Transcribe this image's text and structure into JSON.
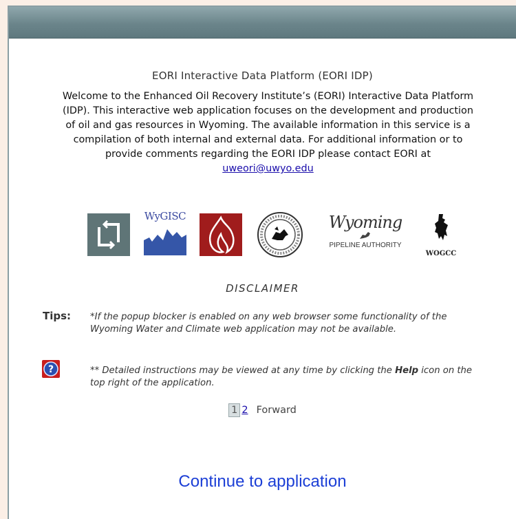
{
  "dialog": {
    "heading": "EORI Interactive Data Platform (EORI IDP)",
    "welcome_text": "Welcome to the Enhanced Oil Recovery Institute’s (EORI) Interactive Data Platform (IDP). This interactive web application focuses on the development and production of oil and gas resources in Wyoming. The available information in this service is a compilation of both internal and external data. For additional information or to provide comments regarding the EORI IDP please contact EORI at ",
    "contact_email": "uweori@uwyo.edu",
    "logos": {
      "wygisc": "WyGISC",
      "wyoming_script": "Wyoming",
      "pipeline_authority": "PIPELINE AUTHORITY",
      "wogcc": "WOGCC"
    },
    "disclaimer_title": "DISCLAIMER",
    "tips_label": "Tips:",
    "tip_popup": "*If the popup blocker is enabled on any web browser some functionality of the Wyoming Water and Climate web application may not be available.",
    "help_tip_prefix": "** Detailed instructions may be viewed at any time by clicking the ",
    "help_tip_bold": "Help",
    "help_tip_suffix": " icon on the top right of the application.",
    "pager": {
      "current_page": "1",
      "next_page": "2",
      "forward_label": "Forward"
    },
    "continue_label": "Continue to application"
  },
  "colors": {
    "titlebar": "#6b858b",
    "page_background": "#fbefe6",
    "link": "#1a0dab",
    "continue_link": "#1c3fd6"
  }
}
